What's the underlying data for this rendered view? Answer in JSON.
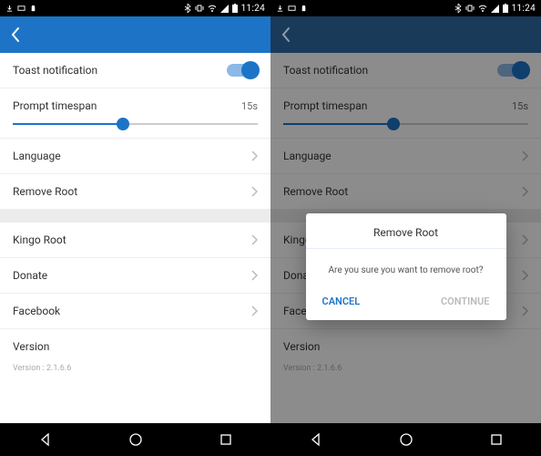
{
  "statusbar": {
    "time": "11:24"
  },
  "screens": [
    {
      "appbar_style": "light",
      "has_dialog": false
    },
    {
      "appbar_style": "dark",
      "has_dialog": true
    }
  ],
  "settings": {
    "toast_label": "Toast notification",
    "toast_on": true,
    "timespan_label": "Prompt timespan",
    "timespan_value": "15s",
    "slider_percent": 45,
    "language_label": "Language",
    "remove_root_label": "Remove Root",
    "kingo_label": "Kingo Root",
    "donate_label": "Donate",
    "facebook_label": "Facebook",
    "version_label": "Version",
    "version_value": "Version : 2.1.6.6"
  },
  "dialog": {
    "title": "Remove Root",
    "message": "Are you sure you want to remove root?",
    "cancel": "CANCEL",
    "continue": "CONTINUE"
  }
}
